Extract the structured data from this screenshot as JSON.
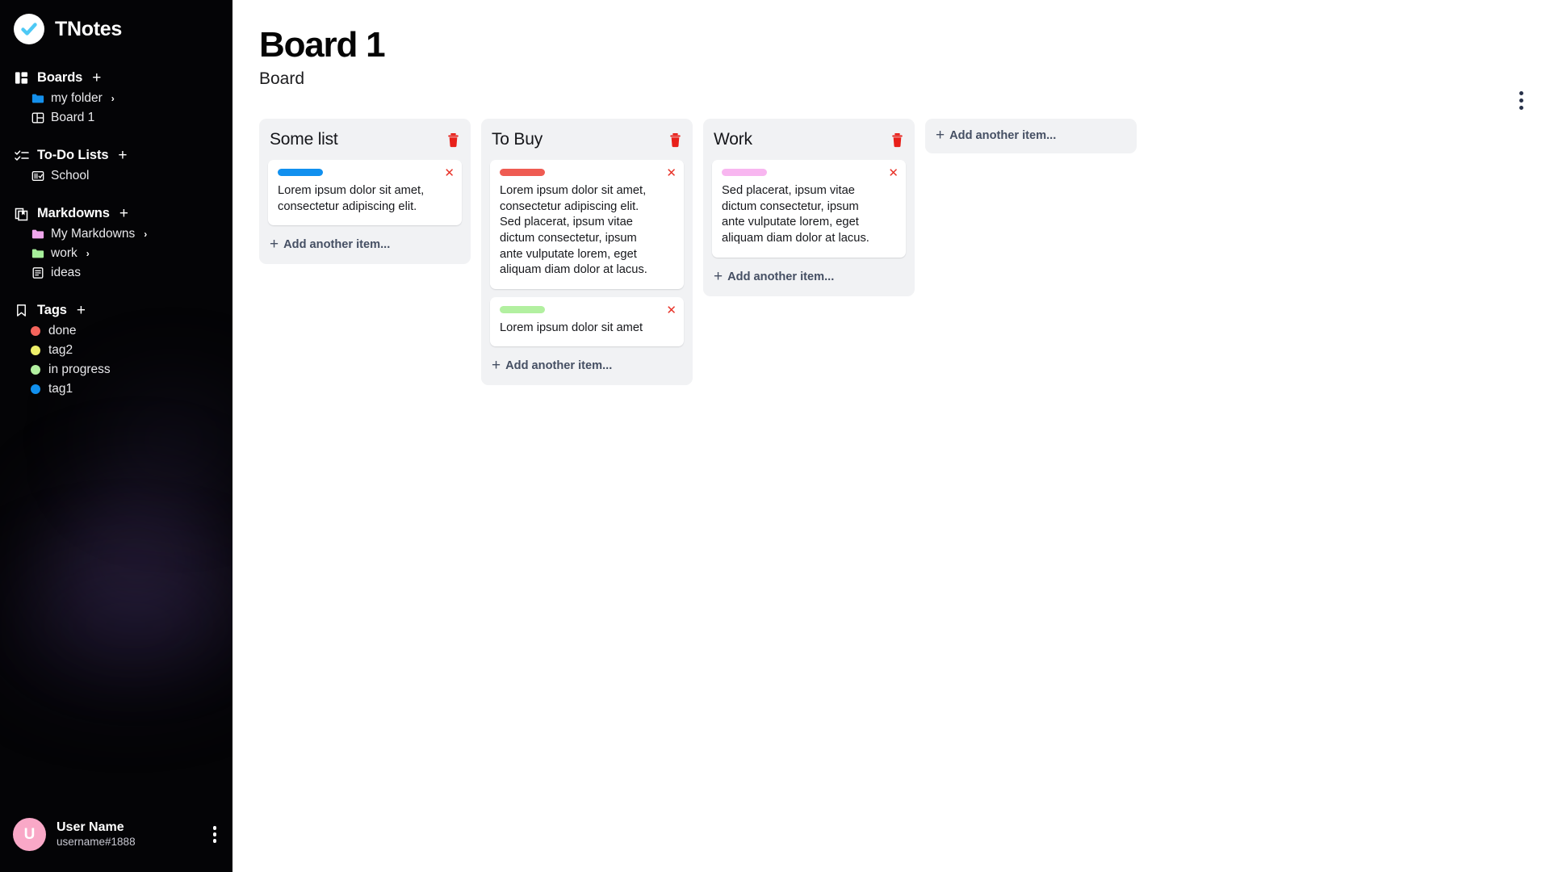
{
  "app": {
    "brand_name": "TNotes",
    "logo_icon": "check-circle-icon"
  },
  "sidebar": {
    "sections": [
      {
        "id": "boards",
        "label": "Boards",
        "icon": "layout-columns-icon",
        "add_label": "+",
        "items": [
          {
            "label": "my folder",
            "icon": "folder-icon",
            "color": "#1490ec",
            "expandable": true,
            "chevron": "›"
          },
          {
            "label": "Board 1",
            "icon": "board-icon",
            "color": "#ffffff",
            "expandable": false,
            "chevron": ""
          }
        ]
      },
      {
        "id": "todo-lists",
        "label": "To-Do Lists",
        "icon": "checklist-icon",
        "add_label": "+",
        "items": [
          {
            "label": "School",
            "icon": "todo-list-icon",
            "color": "#ffffff",
            "expandable": false,
            "chevron": ""
          }
        ]
      },
      {
        "id": "markdowns",
        "label": "Markdowns",
        "icon": "markdown-stack-icon",
        "add_label": "+",
        "items": [
          {
            "label": "My Markdowns",
            "icon": "folder-icon",
            "color": "#f0a6ed",
            "expandable": true,
            "chevron": "›"
          },
          {
            "label": "work",
            "icon": "folder-icon",
            "color": "#a6ef9a",
            "expandable": true,
            "chevron": "›"
          },
          {
            "label": "ideas",
            "icon": "document-icon",
            "color": "#ffffff",
            "expandable": false,
            "chevron": ""
          }
        ]
      }
    ],
    "tags_section": {
      "id": "tags",
      "label": "Tags",
      "icon": "bookmark-icon",
      "add_label": "+",
      "tags": [
        {
          "label": "done",
          "color": "#f4645c"
        },
        {
          "label": "tag2",
          "color": "#eef06a"
        },
        {
          "label": "in progress",
          "color": "#b2f0a0"
        },
        {
          "label": "tag1",
          "color": "#1190ef"
        }
      ]
    },
    "user": {
      "avatar_letter": "U",
      "avatar_color": "#f9a8c7",
      "name": "User Name",
      "handle": "username#1888",
      "menu_icon": "kebab-menu-icon"
    }
  },
  "main": {
    "title": "Board 1",
    "subtitle": "Board",
    "menu_icon": "kebab-menu-icon",
    "add_list_label": "Add another item...",
    "lists": [
      {
        "title": "Some list",
        "delete_icon": "trash-icon",
        "add_item_label": "Add another item...",
        "cards": [
          {
            "pill_color": "#1190ef",
            "text": "Lorem ipsum dolor sit amet, consectetur adipiscing elit.",
            "close_icon": "close-icon"
          }
        ]
      },
      {
        "title": "To Buy",
        "delete_icon": "trash-icon",
        "add_item_label": "Add another item...",
        "cards": [
          {
            "pill_color": "#ef5b52",
            "text": "Lorem ipsum dolor sit amet, consectetur adipiscing elit. Sed placerat, ipsum vitae dictum consectetur, ipsum ante vulputate lorem, eget aliquam diam dolor at lacus.",
            "close_icon": "close-icon"
          },
          {
            "pill_color": "#b2f0a0",
            "text": "Lorem ipsum dolor sit amet",
            "close_icon": "close-icon"
          }
        ]
      },
      {
        "title": "Work",
        "delete_icon": "trash-icon",
        "add_item_label": "Add another item...",
        "cards": [
          {
            "pill_color": "#f8b6f0",
            "text": "Sed placerat, ipsum vitae dictum consectetur, ipsum ante vulputate lorem, eget aliquam diam dolor at lacus.",
            "close_icon": "close-icon"
          }
        ]
      }
    ]
  },
  "colors": {
    "sidebar_bg": "#040406",
    "list_bg": "#f1f2f4",
    "card_bg": "#ffffff",
    "accent_red": "#e8342a",
    "text_dark": "#17181c"
  }
}
